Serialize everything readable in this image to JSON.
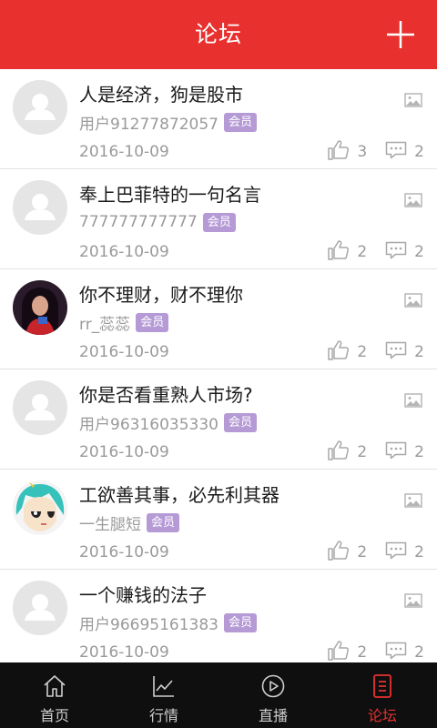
{
  "header": {
    "title": "论坛"
  },
  "posts": [
    {
      "title": "人是经济，狗是股市",
      "author": "用户91277872057",
      "badge": "会员",
      "date": "2016-10-09",
      "likes": "3",
      "comments": "2",
      "avatar": "default"
    },
    {
      "title": "奉上巴菲特的一句名言",
      "author": "777777777777",
      "badge": "会员",
      "date": "2016-10-09",
      "likes": "2",
      "comments": "2",
      "avatar": "default"
    },
    {
      "title": "你不理财，财不理你",
      "author": "rr_蕊蕊",
      "badge": "会员",
      "date": "2016-10-09",
      "likes": "2",
      "comments": "2",
      "avatar": "photo"
    },
    {
      "title": "你是否看重熟人市场?",
      "author": "用户96316035330",
      "badge": "会员",
      "date": "2016-10-09",
      "likes": "2",
      "comments": "2",
      "avatar": "default"
    },
    {
      "title": "工欲善其事，必先利其器",
      "author": "一生腿短",
      "badge": "会员",
      "date": "2016-10-09",
      "likes": "2",
      "comments": "2",
      "avatar": "cartoon"
    },
    {
      "title": "一个赚钱的法子",
      "author": "用户96695161383",
      "badge": "会员",
      "date": "2016-10-09",
      "likes": "2",
      "comments": "2",
      "avatar": "default"
    }
  ],
  "tabs": [
    {
      "label": "首页",
      "icon": "home-icon"
    },
    {
      "label": "行情",
      "icon": "chart-icon"
    },
    {
      "label": "直播",
      "icon": "play-icon"
    },
    {
      "label": "论坛",
      "icon": "forum-icon",
      "active": true
    }
  ],
  "colors": {
    "brand": "#e8312f",
    "badge": "#b59ad6",
    "tabbar": "#0f0f0f"
  }
}
